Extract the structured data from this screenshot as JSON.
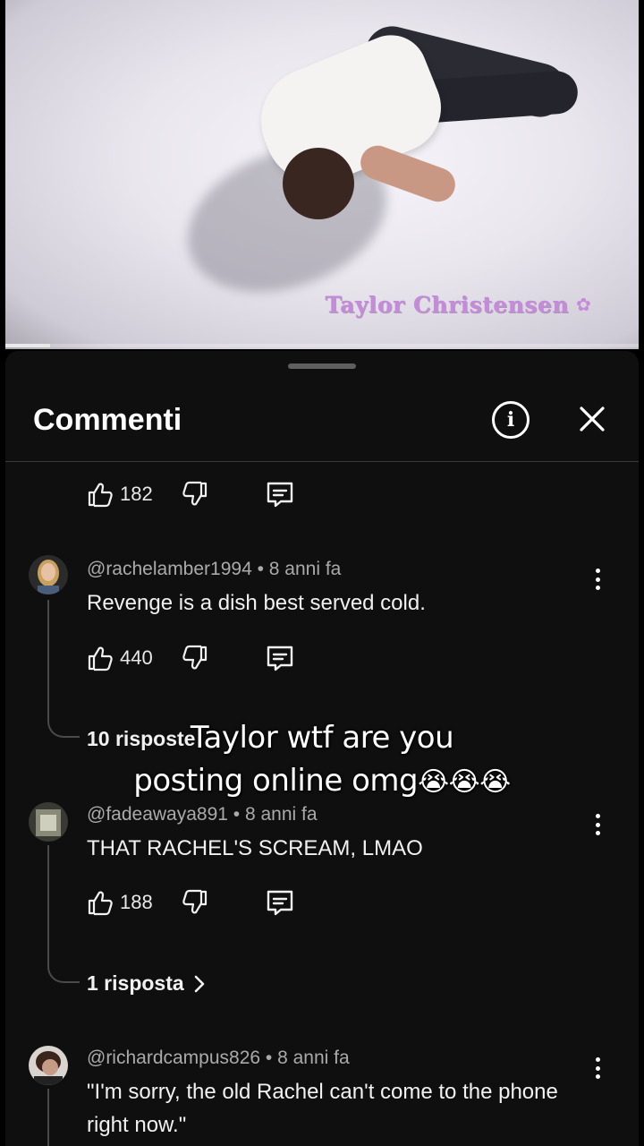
{
  "video": {
    "watermark": "Taylor Christensen",
    "progress_percent": 7
  },
  "sheet": {
    "title": "Commenti"
  },
  "top_actions": {
    "likes": "182"
  },
  "comments": [
    {
      "meta": "@rachelamber1994 • 8 anni fa",
      "text": "Revenge is a dish best served cold.",
      "likes": "440",
      "replies_label": "10 risposte"
    },
    {
      "meta": "@fadeawaya891 • 8 anni fa",
      "text": "THAT RACHEL'S SCREAM, LMAO",
      "likes": "188",
      "replies_label": "1 risposta"
    },
    {
      "meta": "@richardcampus826 • 8 anni fa",
      "text": "\"I'm sorry, the old Rachel can't come to the phone right now.\""
    }
  ],
  "overlay": {
    "line1": "Taylor wtf are you",
    "line2": "posting online omg",
    "emoji": "😭😭😭"
  },
  "icons": {
    "like": "thumbs-up-icon",
    "dislike": "thumbs-down-icon",
    "reply": "reply-comment-icon",
    "info": "info-icon",
    "close": "close-icon",
    "more": "more-vertical-icon"
  },
  "colors": {
    "sheet_bg": "#0f0f0f",
    "meta_text": "#aaaaaa",
    "watermark": "#c58ad9"
  }
}
